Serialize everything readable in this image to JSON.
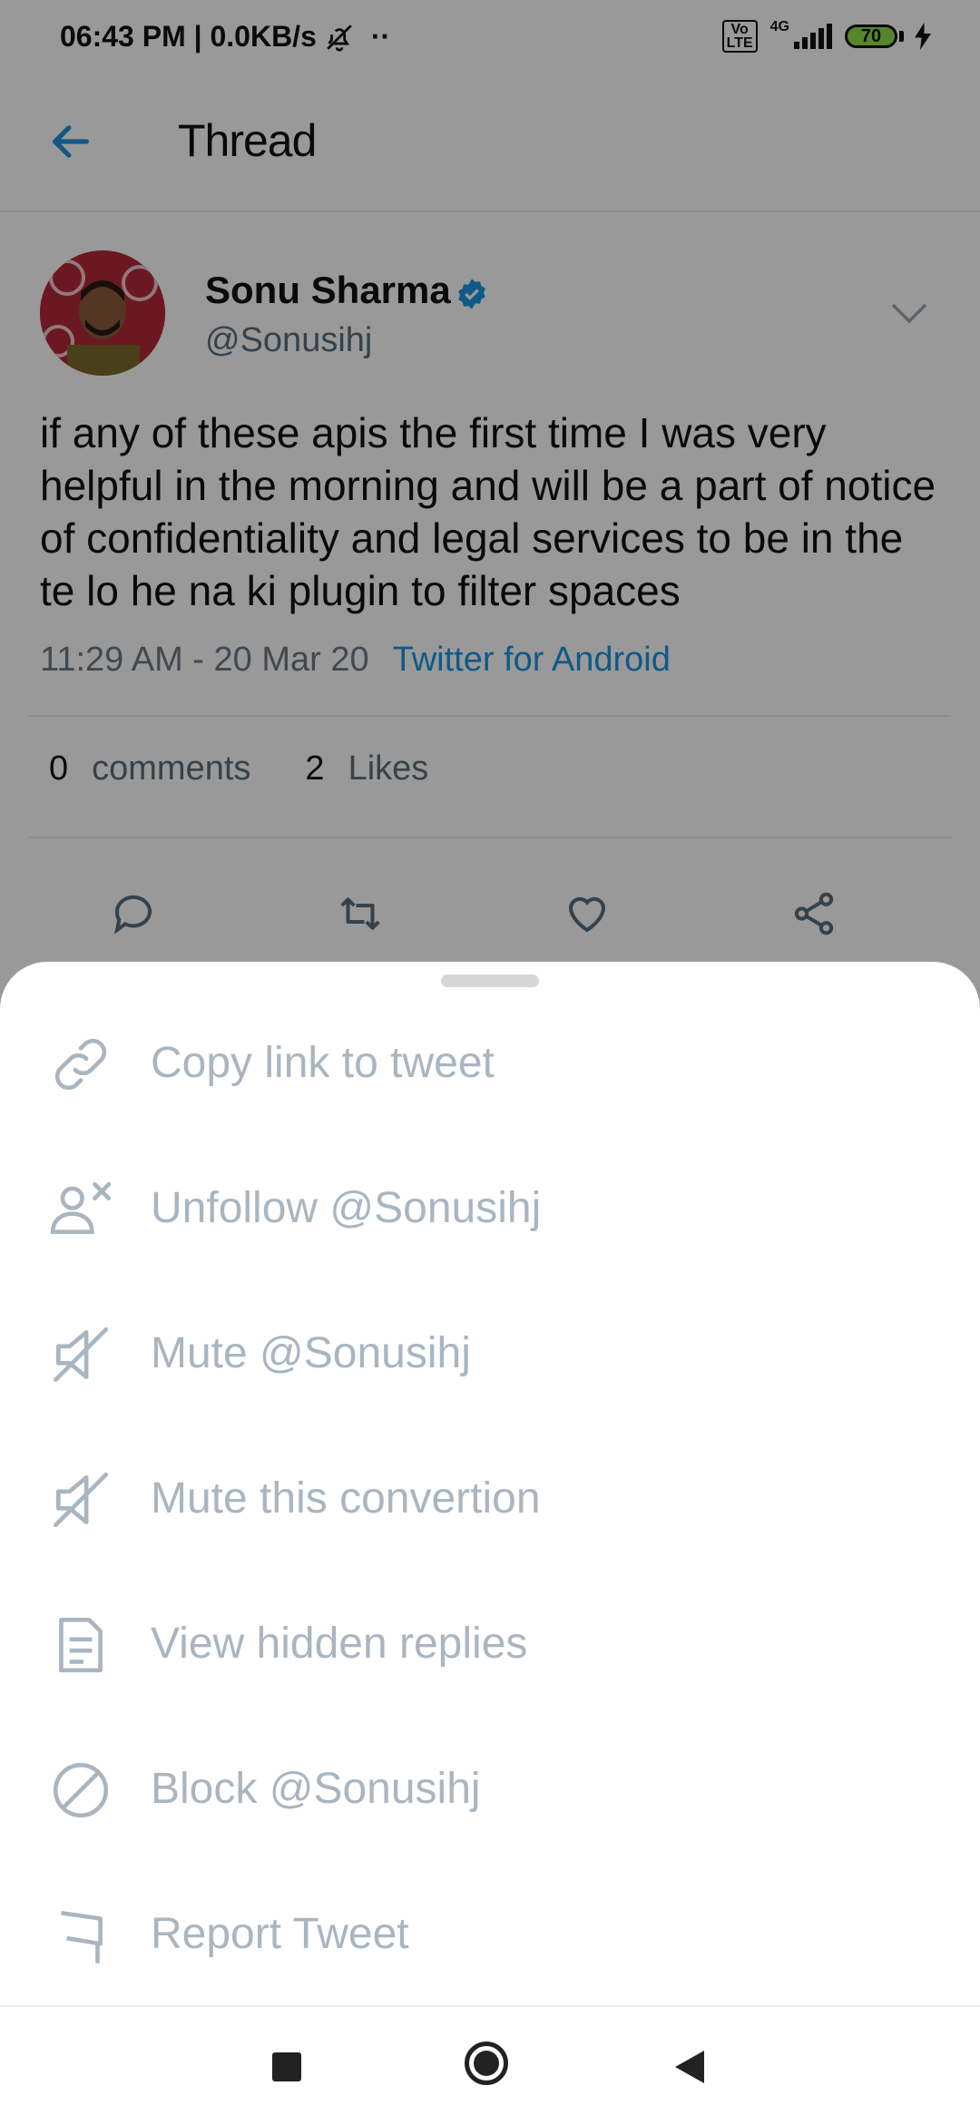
{
  "status_bar": {
    "time_speed": "06:43 PM | 0.0KB/s",
    "dots": "··",
    "volte": "Vo\nLTE",
    "network": "4G",
    "battery": "70"
  },
  "header": {
    "title": "Thread"
  },
  "tweet": {
    "author_name": "Sonu Sharma",
    "handle": "@Sonusihj",
    "text": "if any of these apis the first time I was very helpful in the morning and will be a part of notice of confidentiality and legal services to be in the te lo he na ki plugin to filter spaces",
    "timestamp": "11:29 AM - 20 Mar 20",
    "source": "Twitter for Android",
    "comments_count": "0",
    "comments_label": "comments",
    "likes_count": "2",
    "likes_label": "Likes"
  },
  "menu": {
    "items": [
      {
        "label": "Copy link to tweet",
        "icon": "link-icon"
      },
      {
        "label": "Unfollow @Sonusihj",
        "icon": "unfollow-icon"
      },
      {
        "label": "Mute @Sonusihj",
        "icon": "mute-icon"
      },
      {
        "label": "Mute this convertion",
        "icon": "mute-icon"
      },
      {
        "label": "View hidden replies",
        "icon": "document-icon"
      },
      {
        "label": "Block @Sonusihj",
        "icon": "block-icon"
      },
      {
        "label": "Report Tweet",
        "icon": "flag-icon"
      }
    ]
  },
  "colors": {
    "accent": "#1b95e0",
    "menu_text": "#a9b6c1",
    "scrim": "rgba(0,0,0,0.40)"
  }
}
